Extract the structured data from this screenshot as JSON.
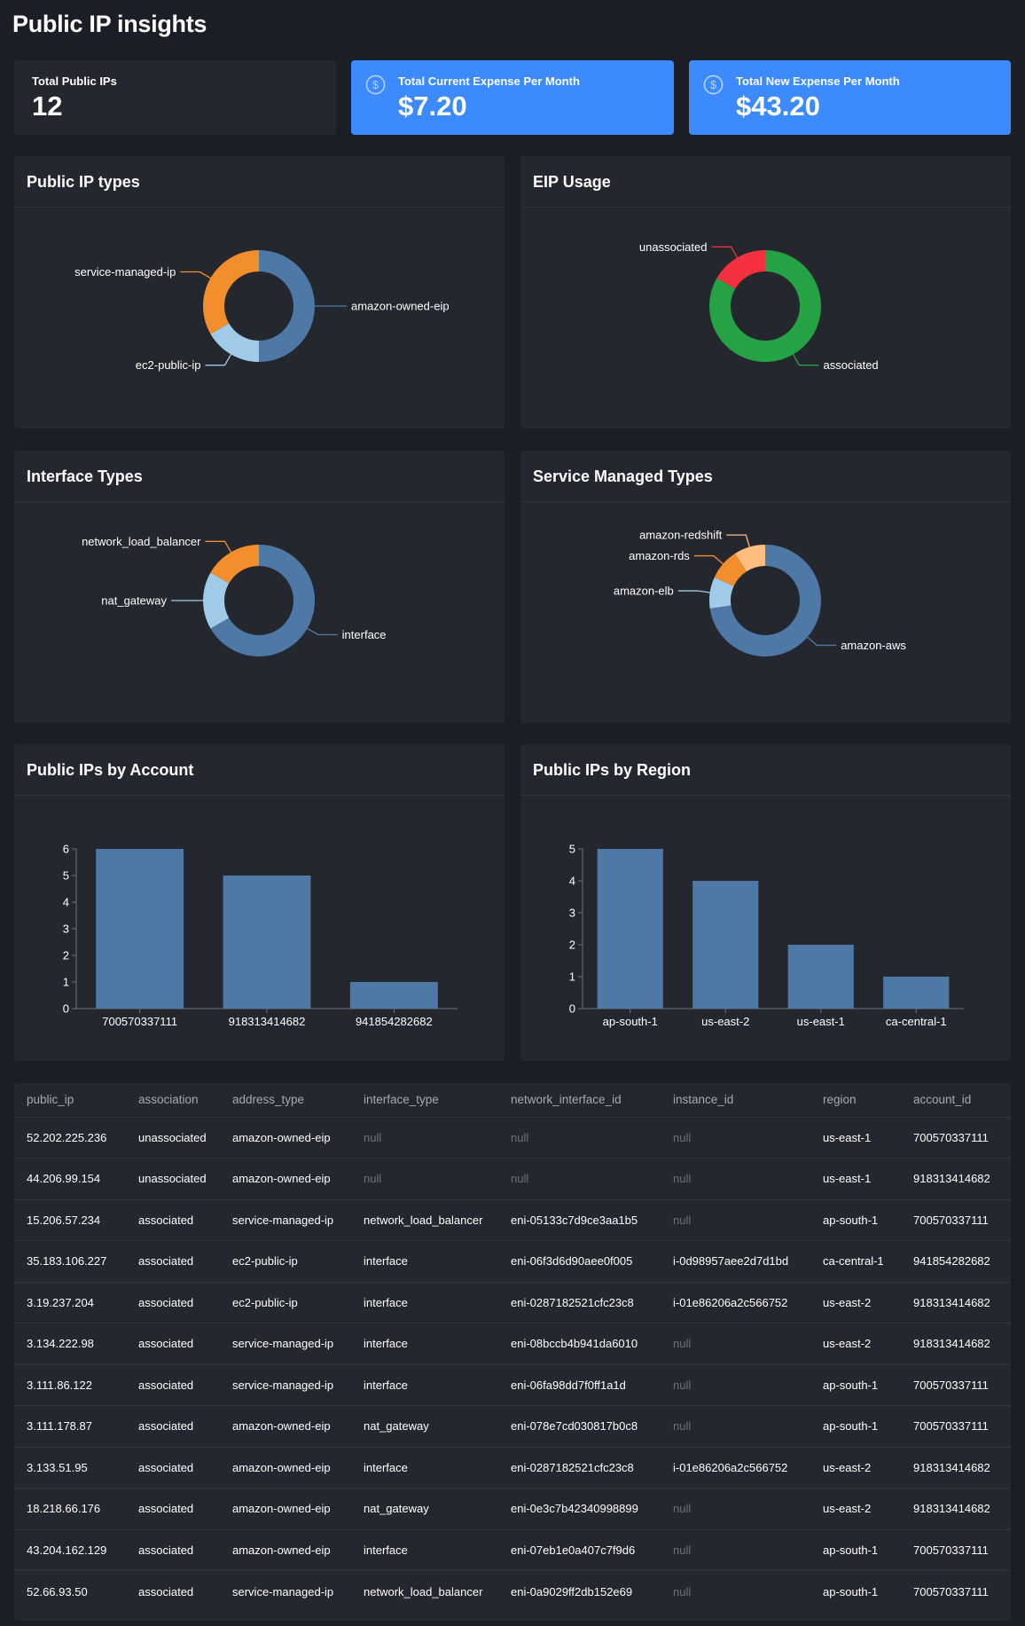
{
  "page": {
    "title": "Public IP insights"
  },
  "kpis": [
    {
      "label": "Total Public IPs",
      "value": "12",
      "style": "plain",
      "icon": ""
    },
    {
      "label": "Total Current Expense Per Month",
      "value": "$7.20",
      "style": "blue",
      "icon": "dollar-circle-icon"
    },
    {
      "label": "Total New Expense Per Month",
      "value": "$43.20",
      "style": "blue",
      "icon": "dollar-circle-icon"
    }
  ],
  "colors": {
    "page_bg": "#1b1e24",
    "panel_bg": "#24272e",
    "kpi_blue": "#3d8aff",
    "steel_blue": "#4e79a7",
    "orange": "#f28e2b",
    "light_blue": "#a0cbe8",
    "light_orange": "#ffbe7d",
    "red": "#f5313f",
    "green": "#25a244"
  },
  "panels": {
    "ip_types": {
      "title": "Public IP types"
    },
    "eip_usage": {
      "title": "EIP Usage"
    },
    "interface_types": {
      "title": "Interface Types"
    },
    "service_managed": {
      "title": "Service Managed Types"
    },
    "by_account": {
      "title": "Public IPs by Account"
    },
    "by_region": {
      "title": "Public IPs by Region"
    }
  },
  "chart_data": [
    {
      "id": "ip_types",
      "type": "pie",
      "donut": true,
      "slices": [
        {
          "label": "amazon-owned-eip",
          "value": 6,
          "color": "#4e79a7"
        },
        {
          "label": "ec2-public-ip",
          "value": 2,
          "color": "#a0cbe8"
        },
        {
          "label": "service-managed-ip",
          "value": 4,
          "color": "#f28e2b"
        }
      ]
    },
    {
      "id": "eip_usage",
      "type": "pie",
      "donut": true,
      "slices": [
        {
          "label": "associated",
          "value": 10,
          "color": "#25a244"
        },
        {
          "label": "unassociated",
          "value": 2,
          "color": "#f5313f"
        }
      ]
    },
    {
      "id": "interface_types",
      "type": "pie",
      "donut": true,
      "slices": [
        {
          "label": "interface",
          "value": 8,
          "color": "#4e79a7"
        },
        {
          "label": "nat_gateway",
          "value": 2,
          "color": "#a0cbe8"
        },
        {
          "label": "network_load_balancer",
          "value": 2,
          "color": "#f28e2b"
        }
      ]
    },
    {
      "id": "service_managed",
      "type": "pie",
      "donut": true,
      "slices": [
        {
          "label": "amazon-aws",
          "value": 8,
          "color": "#4e79a7"
        },
        {
          "label": "amazon-elb",
          "value": 1,
          "color": "#a0cbe8"
        },
        {
          "label": "amazon-rds",
          "value": 1,
          "color": "#f28e2b"
        },
        {
          "label": "amazon-redshift",
          "value": 1,
          "color": "#ffbe7d"
        }
      ]
    },
    {
      "id": "by_account",
      "type": "bar",
      "categories": [
        "700570337111",
        "918313414682",
        "941854282682"
      ],
      "values": [
        6,
        5,
        1
      ],
      "ylim": [
        0,
        6
      ],
      "yticks": [
        0,
        1,
        2,
        3,
        4,
        5,
        6
      ],
      "color": "#4e79a7"
    },
    {
      "id": "by_region",
      "type": "bar",
      "categories": [
        "ap-south-1",
        "us-east-2",
        "us-east-1",
        "ca-central-1"
      ],
      "values": [
        5,
        4,
        2,
        1
      ],
      "ylim": [
        0,
        5
      ],
      "yticks": [
        0,
        1,
        2,
        3,
        4,
        5
      ],
      "color": "#4e79a7"
    }
  ],
  "table": {
    "columns": [
      "public_ip",
      "association",
      "address_type",
      "interface_type",
      "network_interface_id",
      "instance_id",
      "region",
      "account_id"
    ],
    "rows": [
      [
        "52.202.225.236",
        "unassociated",
        "amazon-owned-eip",
        "null",
        "null",
        "null",
        "us-east-1",
        "700570337111"
      ],
      [
        "44.206.99.154",
        "unassociated",
        "amazon-owned-eip",
        "null",
        "null",
        "null",
        "us-east-1",
        "918313414682"
      ],
      [
        "15.206.57.234",
        "associated",
        "service-managed-ip",
        "network_load_balancer",
        "eni-05133c7d9ce3aa1b5",
        "null",
        "ap-south-1",
        "700570337111"
      ],
      [
        "35.183.106.227",
        "associated",
        "ec2-public-ip",
        "interface",
        "eni-06f3d6d90aee0f005",
        "i-0d98957aee2d7d1bd",
        "ca-central-1",
        "941854282682"
      ],
      [
        "3.19.237.204",
        "associated",
        "ec2-public-ip",
        "interface",
        "eni-0287182521cfc23c8",
        "i-01e86206a2c566752",
        "us-east-2",
        "918313414682"
      ],
      [
        "3.134.222.98",
        "associated",
        "service-managed-ip",
        "interface",
        "eni-08bccb4b941da6010",
        "null",
        "us-east-2",
        "918313414682"
      ],
      [
        "3.111.86.122",
        "associated",
        "service-managed-ip",
        "interface",
        "eni-06fa98dd7f0ff1a1d",
        "null",
        "ap-south-1",
        "700570337111"
      ],
      [
        "3.111.178.87",
        "associated",
        "amazon-owned-eip",
        "nat_gateway",
        "eni-078e7cd030817b0c8",
        "null",
        "ap-south-1",
        "700570337111"
      ],
      [
        "3.133.51.95",
        "associated",
        "amazon-owned-eip",
        "interface",
        "eni-0287182521cfc23c8",
        "i-01e86206a2c566752",
        "us-east-2",
        "918313414682"
      ],
      [
        "18.218.66.176",
        "associated",
        "amazon-owned-eip",
        "nat_gateway",
        "eni-0e3c7b42340998899",
        "null",
        "us-east-2",
        "918313414682"
      ],
      [
        "43.204.162.129",
        "associated",
        "amazon-owned-eip",
        "interface",
        "eni-07eb1e0a407c7f9d6",
        "null",
        "ap-south-1",
        "700570337111"
      ],
      [
        "52.66.93.50",
        "associated",
        "service-managed-ip",
        "network_load_balancer",
        "eni-0a9029ff2db152e69",
        "null",
        "ap-south-1",
        "700570337111"
      ]
    ]
  }
}
